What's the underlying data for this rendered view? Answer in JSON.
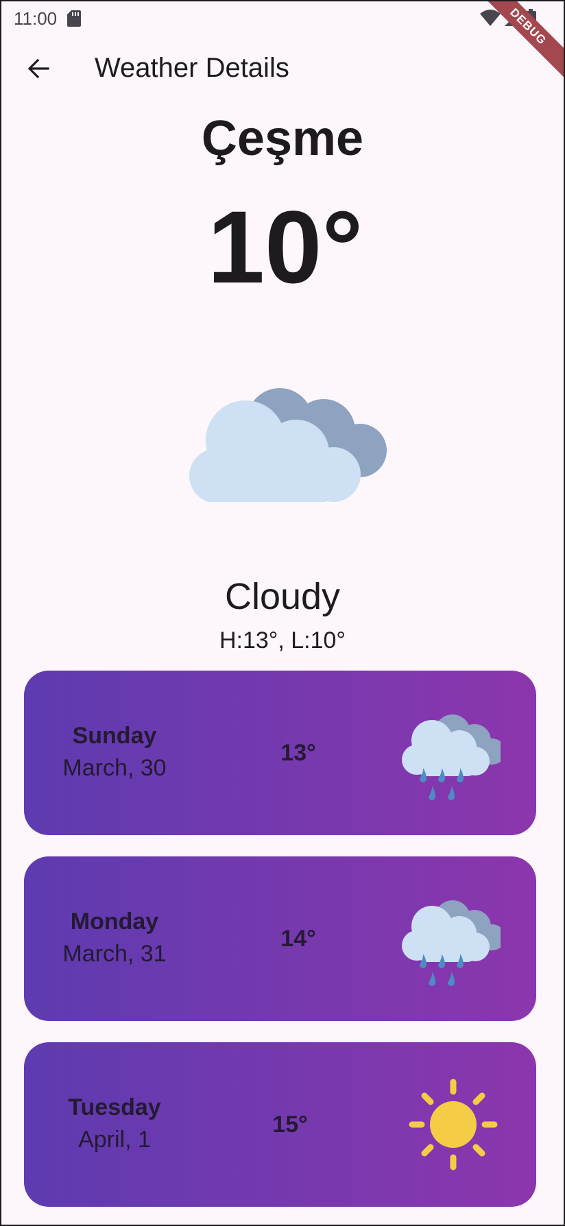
{
  "status_bar": {
    "time": "11:00",
    "debug_label": "DEBUG"
  },
  "app_bar": {
    "title": "Weather Details",
    "back_icon": "arrow-back-icon"
  },
  "current": {
    "city": "Çeşme",
    "temperature": "10°",
    "condition": "Cloudy",
    "high_low": "H:13°, L:10°",
    "icon": "cloudy-icon"
  },
  "forecast": [
    {
      "day": "Sunday",
      "date": "March, 30",
      "temperature": "13°",
      "icon": "rain-icon"
    },
    {
      "day": "Monday",
      "date": "March, 31",
      "temperature": "14°",
      "icon": "rain-icon"
    },
    {
      "day": "Tuesday",
      "date": "April, 1",
      "temperature": "15°",
      "icon": "sun-icon"
    }
  ],
  "colors": {
    "background": "#fdf7fc",
    "card_gradient_start": "#5e3bb0",
    "card_gradient_end": "#8c36ad",
    "cloud_light": "#cde0f4",
    "cloud_dark": "#8da3bf",
    "rain_drop": "#4f8bc4",
    "sun": "#f5cc45"
  }
}
